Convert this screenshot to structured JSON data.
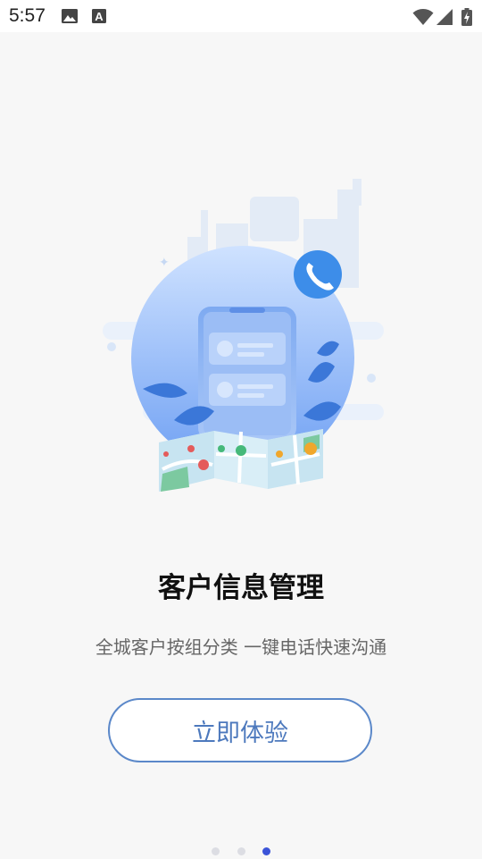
{
  "status_bar": {
    "time": "5:57",
    "left_icons": [
      "image-icon",
      "text-a-icon"
    ],
    "right_icons": [
      "wifi-icon",
      "signal-icon",
      "battery-charging-icon"
    ]
  },
  "onboarding": {
    "title": "客户信息管理",
    "subtitle": "全城客户按组分类 一键电话快速沟通",
    "cta_label": "立即体验",
    "page_index": 3,
    "page_count": 3
  },
  "colors": {
    "accent": "#4d79bd",
    "active_dot": "#3b54d8",
    "inactive_dot": "#dcdde3",
    "phone_badge": "#3d8de9"
  }
}
